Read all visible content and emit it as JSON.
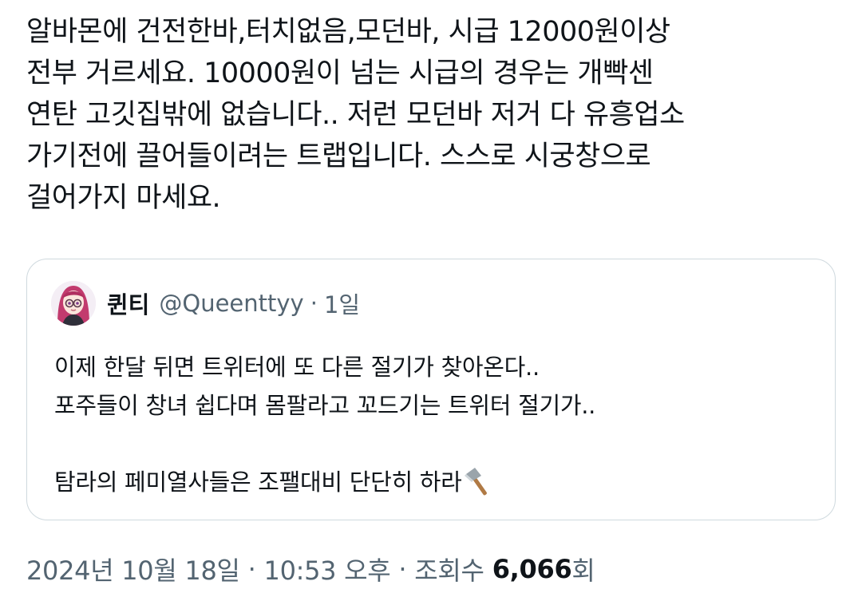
{
  "tweet": {
    "lines": [
      "알바몬에 건전한바,터치없음,모던바, 시급 12000원이상",
      "전부 거르세요. 10000원이 넘는 시급의 경우는 개빡센",
      "연탄 고깃집밖에 없습니다.. 저런 모던바 저거 다 유흥업소",
      "가기전에 끌어들이려는 트랩입니다. 스스로 시궁창으로",
      "걸어가지 마세요."
    ]
  },
  "quote": {
    "author_name": "퀸티",
    "author_handle": "@Queenttyy",
    "separator": "·",
    "time": "1일",
    "lines": [
      "이제 한달 뒤면 트위터에 또 다른 절기가 찾아온다..",
      "포주들이 창녀 쉽다며 몸팔라고 꼬드기는 트위터 절기가..",
      "",
      "탐라의 페미열사들은 조팰대비 단단히 하라"
    ],
    "emoji_icon": "axe-icon"
  },
  "meta": {
    "date": "2024년 10월 18일",
    "separator": "·",
    "time": "10:53 오후",
    "views_label": "조회수",
    "views_count": "6,066",
    "views_suffix": "회"
  },
  "colors": {
    "text": "#0f1419",
    "secondary": "#536471",
    "border": "#cfd9de"
  }
}
